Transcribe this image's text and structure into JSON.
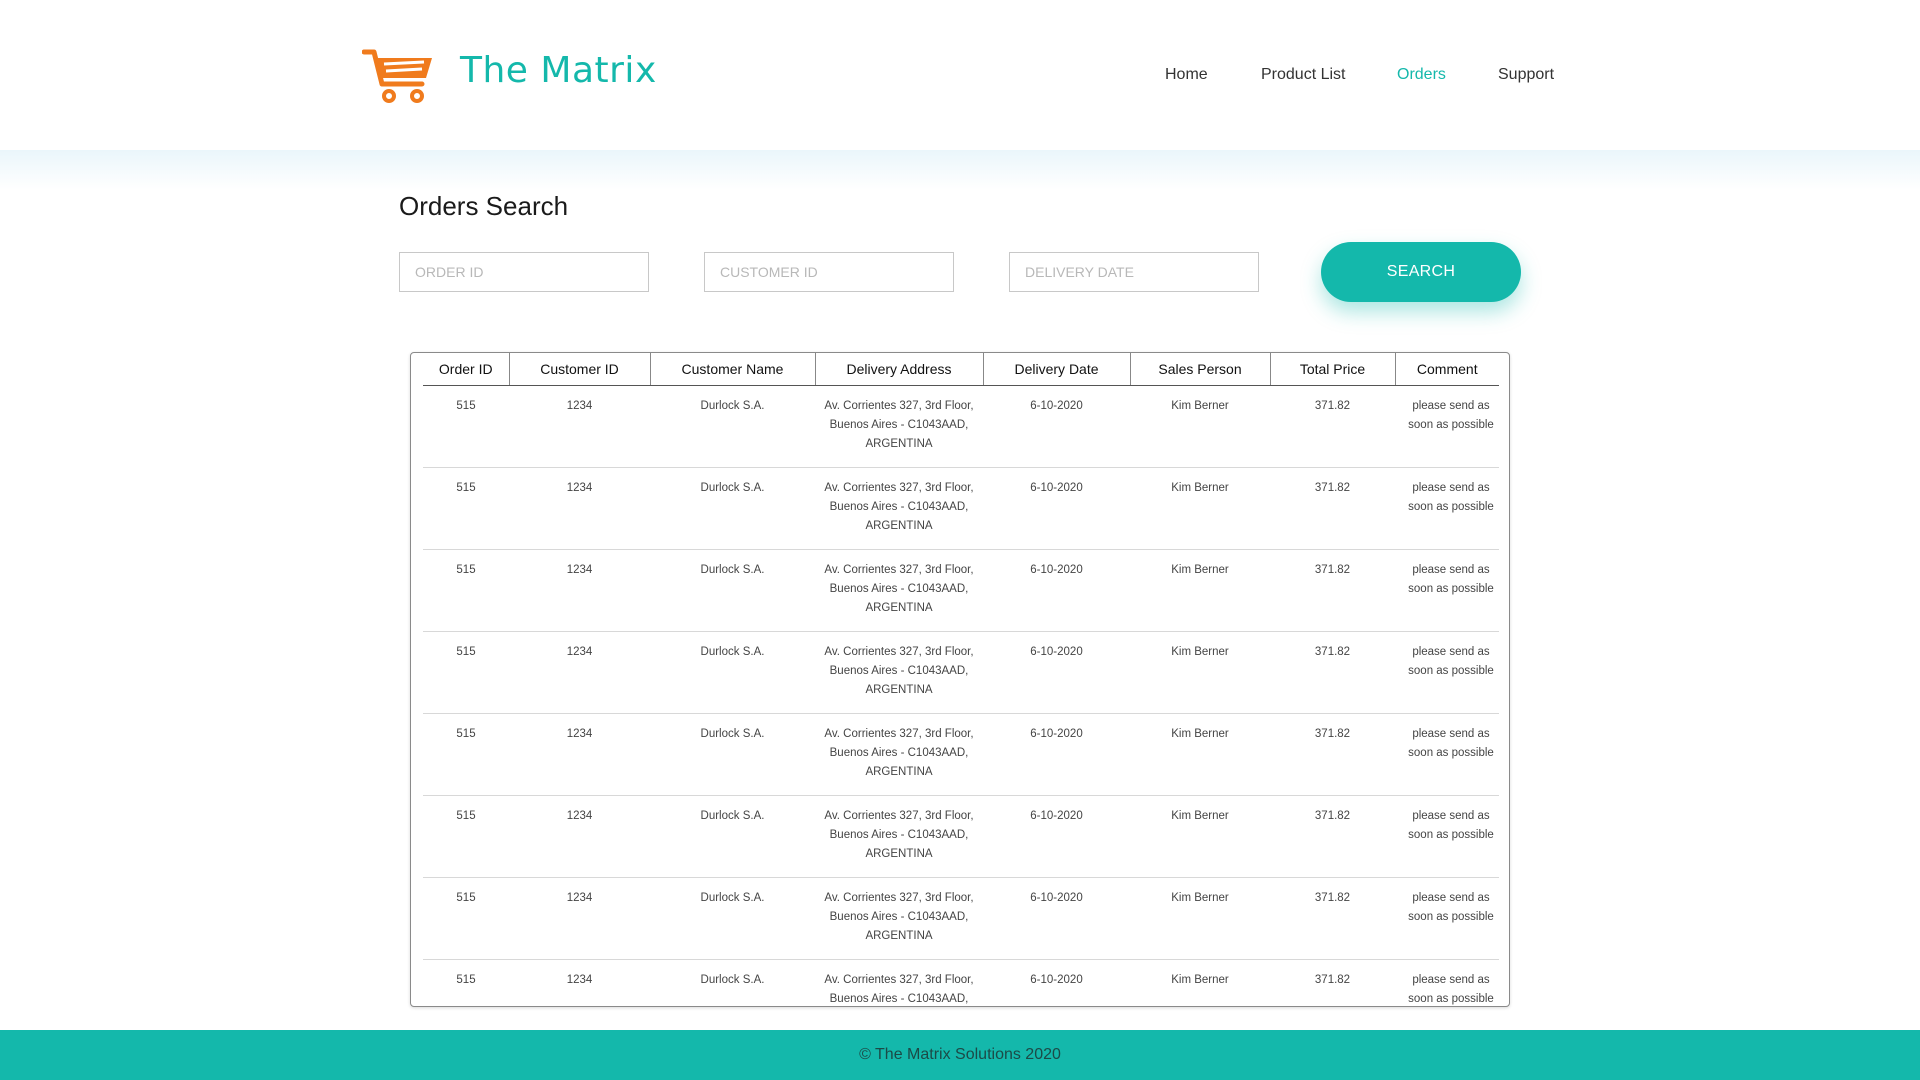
{
  "header": {
    "brand": "The Matrix",
    "logo_icon": "shopping-cart-icon",
    "nav": [
      {
        "label": "Home"
      },
      {
        "label": "Product List"
      },
      {
        "label": "Orders"
      },
      {
        "label": "Support"
      }
    ],
    "active_nav": "Orders"
  },
  "search": {
    "title": "Orders Search",
    "order_id_placeholder": "ORDER ID",
    "customer_id_placeholder": "CUSTOMER ID",
    "delivery_date_placeholder": "DELIVERY DATE",
    "button_label": "SEARCH"
  },
  "table": {
    "columns": [
      "Order ID",
      "Customer ID",
      "Customer Name",
      "Delivery Address",
      "Delivery Date",
      "Sales Person",
      "Total Price",
      "Comment"
    ],
    "rows": [
      {
        "order_id": "515",
        "customer_id": "1234",
        "customer_name": "Durlock S.A.",
        "delivery_address": "Av. Corrientes 327, 3rd Floor, Buenos Aires - C1043AAD, ARGENTINA",
        "delivery_date": "6-10-2020",
        "sales_person": "Kim Berner",
        "total_price": "371.82",
        "comment": "please send as soon as possible"
      },
      {
        "order_id": "515",
        "customer_id": "1234",
        "customer_name": "Durlock S.A.",
        "delivery_address": "Av. Corrientes 327, 3rd Floor, Buenos Aires - C1043AAD, ARGENTINA",
        "delivery_date": "6-10-2020",
        "sales_person": "Kim Berner",
        "total_price": "371.82",
        "comment": "please send as soon as possible"
      },
      {
        "order_id": "515",
        "customer_id": "1234",
        "customer_name": "Durlock S.A.",
        "delivery_address": "Av. Corrientes 327, 3rd Floor, Buenos Aires - C1043AAD, ARGENTINA",
        "delivery_date": "6-10-2020",
        "sales_person": "Kim Berner",
        "total_price": "371.82",
        "comment": "please send as soon as possible"
      },
      {
        "order_id": "515",
        "customer_id": "1234",
        "customer_name": "Durlock S.A.",
        "delivery_address": "Av. Corrientes 327, 3rd Floor, Buenos Aires - C1043AAD, ARGENTINA",
        "delivery_date": "6-10-2020",
        "sales_person": "Kim Berner",
        "total_price": "371.82",
        "comment": "please send as soon as possible"
      },
      {
        "order_id": "515",
        "customer_id": "1234",
        "customer_name": "Durlock S.A.",
        "delivery_address": "Av. Corrientes 327, 3rd Floor, Buenos Aires - C1043AAD, ARGENTINA",
        "delivery_date": "6-10-2020",
        "sales_person": "Kim Berner",
        "total_price": "371.82",
        "comment": "please send as soon as possible"
      },
      {
        "order_id": "515",
        "customer_id": "1234",
        "customer_name": "Durlock S.A.",
        "delivery_address": "Av. Corrientes 327, 3rd Floor, Buenos Aires - C1043AAD, ARGENTINA",
        "delivery_date": "6-10-2020",
        "sales_person": "Kim Berner",
        "total_price": "371.82",
        "comment": "please send as soon as possible"
      },
      {
        "order_id": "515",
        "customer_id": "1234",
        "customer_name": "Durlock S.A.",
        "delivery_address": "Av. Corrientes 327, 3rd Floor, Buenos Aires - C1043AAD, ARGENTINA",
        "delivery_date": "6-10-2020",
        "sales_person": "Kim Berner",
        "total_price": "371.82",
        "comment": "please send as soon as possible"
      },
      {
        "order_id": "515",
        "customer_id": "1234",
        "customer_name": "Durlock S.A.",
        "delivery_address": "Av. Corrientes 327, 3rd Floor, Buenos Aires - C1043AAD,",
        "delivery_date": "6-10-2020",
        "sales_person": "Kim Berner",
        "total_price": "371.82",
        "comment": "please send as soon as possible"
      }
    ]
  },
  "footer": {
    "text": "© The Matrix Solutions 2020"
  },
  "colors": {
    "accent": "#14b8ab",
    "cart": "#f07b1d"
  }
}
